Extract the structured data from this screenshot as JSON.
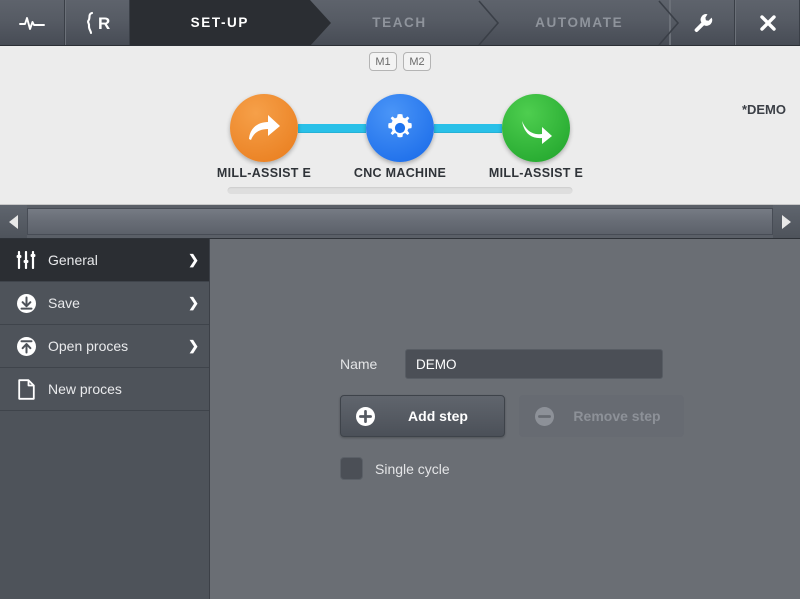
{
  "topbar": {
    "left_buttons": [
      {
        "name": "pulse-icon",
        "title": "Diagnostics"
      },
      {
        "name": "robot-arm-icon",
        "title": "Robot"
      }
    ],
    "tabs": [
      {
        "label": "SET-UP",
        "active": true
      },
      {
        "label": "TEACH",
        "active": false
      },
      {
        "label": "AUTOMATE",
        "active": false
      }
    ],
    "right_buttons": [
      {
        "name": "wrench-icon",
        "title": "Settings"
      },
      {
        "name": "close-icon",
        "title": "Close"
      }
    ]
  },
  "flow": {
    "badges": [
      "M1",
      "M2"
    ],
    "demo_label": "*DEMO",
    "nodes": [
      {
        "label": "MILL-ASSIST E",
        "color": "#f08a2c",
        "icon": "forward-arrow-icon"
      },
      {
        "label": "CNC MACHINE",
        "color": "#2a7df0",
        "icon": "gear-icon"
      },
      {
        "label": "MILL-ASSIST E",
        "color": "#2fb03c",
        "icon": "down-arrow-icon"
      }
    ],
    "connector_color": "#29c0e8"
  },
  "sidebar": {
    "items": [
      {
        "label": "General",
        "icon": "sliders-icon",
        "active": true,
        "chevron": true
      },
      {
        "label": "Save",
        "icon": "download-circle-icon",
        "active": false,
        "chevron": true
      },
      {
        "label": "Open proces",
        "icon": "upload-circle-icon",
        "active": false,
        "chevron": true
      },
      {
        "label": "New proces",
        "icon": "document-icon",
        "active": false,
        "chevron": false
      }
    ],
    "chevron_glyph": "❯"
  },
  "main": {
    "name_label": "Name",
    "name_value": "DEMO",
    "name_placeholder": "",
    "add_step_label": "Add step",
    "remove_step_label": "Remove step",
    "single_cycle_label": "Single cycle",
    "single_cycle_checked": false
  }
}
